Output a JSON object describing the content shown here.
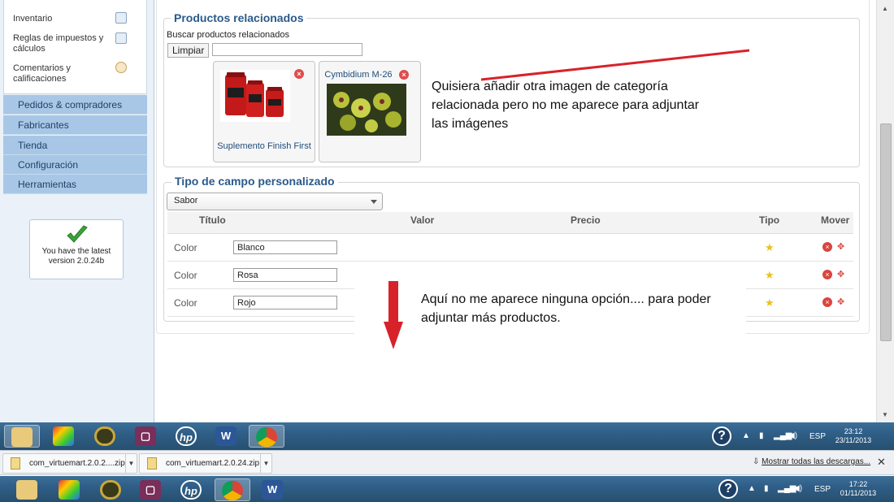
{
  "sidebar": {
    "sub_items": [
      {
        "label": "Inventario",
        "icon": "inventory-icon"
      },
      {
        "label": "Reglas de impuestos y cálculos",
        "icon": "calculator-icon"
      },
      {
        "label": "Comentarios y calificaciones",
        "icon": "comments-icon"
      }
    ],
    "nav_items": [
      {
        "label": "Pedidos & compradores"
      },
      {
        "label": "Fabricantes"
      },
      {
        "label": "Tienda"
      },
      {
        "label": "Configuración"
      },
      {
        "label": "Herramientas"
      }
    ],
    "version_text": "You have the latest version 2.0.24b"
  },
  "related": {
    "legend": "Productos relacionados",
    "search_label": "Buscar productos relacionados",
    "clear_button": "Limpiar",
    "search_value": "",
    "products": [
      {
        "name": "Suplemento Finish First",
        "image": "supplement-jars-image"
      },
      {
        "name": "Cymbidium M-26",
        "image": "orchid-image"
      }
    ]
  },
  "annotations": {
    "top": "Quisiera añadir otra imagen de categoría relacionada pero no me aparece para adjuntar las imágenes",
    "bottom": "Aquí no me aparece ninguna opción.... para poder adjuntar más productos."
  },
  "custom_fields": {
    "legend": "Tipo de campo personalizado",
    "select_value": "Sabor",
    "headers": {
      "title": "Título",
      "value": "Valor",
      "price": "Precio",
      "type": "Tipo",
      "move": "Mover"
    },
    "rows": [
      {
        "title": "Color",
        "value": "Blanco"
      },
      {
        "title": "Color",
        "value": "Rosa"
      },
      {
        "title": "Color",
        "value": "Rojo"
      }
    ]
  },
  "taskbar_top": {
    "apps": [
      "explorer",
      "puzzle",
      "media",
      "presenter",
      "hp",
      "word",
      "chrome"
    ],
    "lang": "ESP",
    "time": "23:12",
    "date": "23/11/2013"
  },
  "downloads": {
    "items": [
      "com_virtuemart.2.0.2....zip",
      "com_virtuemart.2.0.24.zip"
    ],
    "show_all": "Mostrar todas las descargas..."
  },
  "taskbar_bottom": {
    "apps": [
      "explorer",
      "puzzle",
      "media",
      "presenter",
      "hp",
      "chrome",
      "word"
    ],
    "lang": "ESP",
    "time": "17:22",
    "date": "01/11/2013"
  },
  "colors": {
    "nav_bg": "#a8c7e6",
    "legend": "#2a5a8a",
    "annotation_arrow": "#d8222a"
  }
}
